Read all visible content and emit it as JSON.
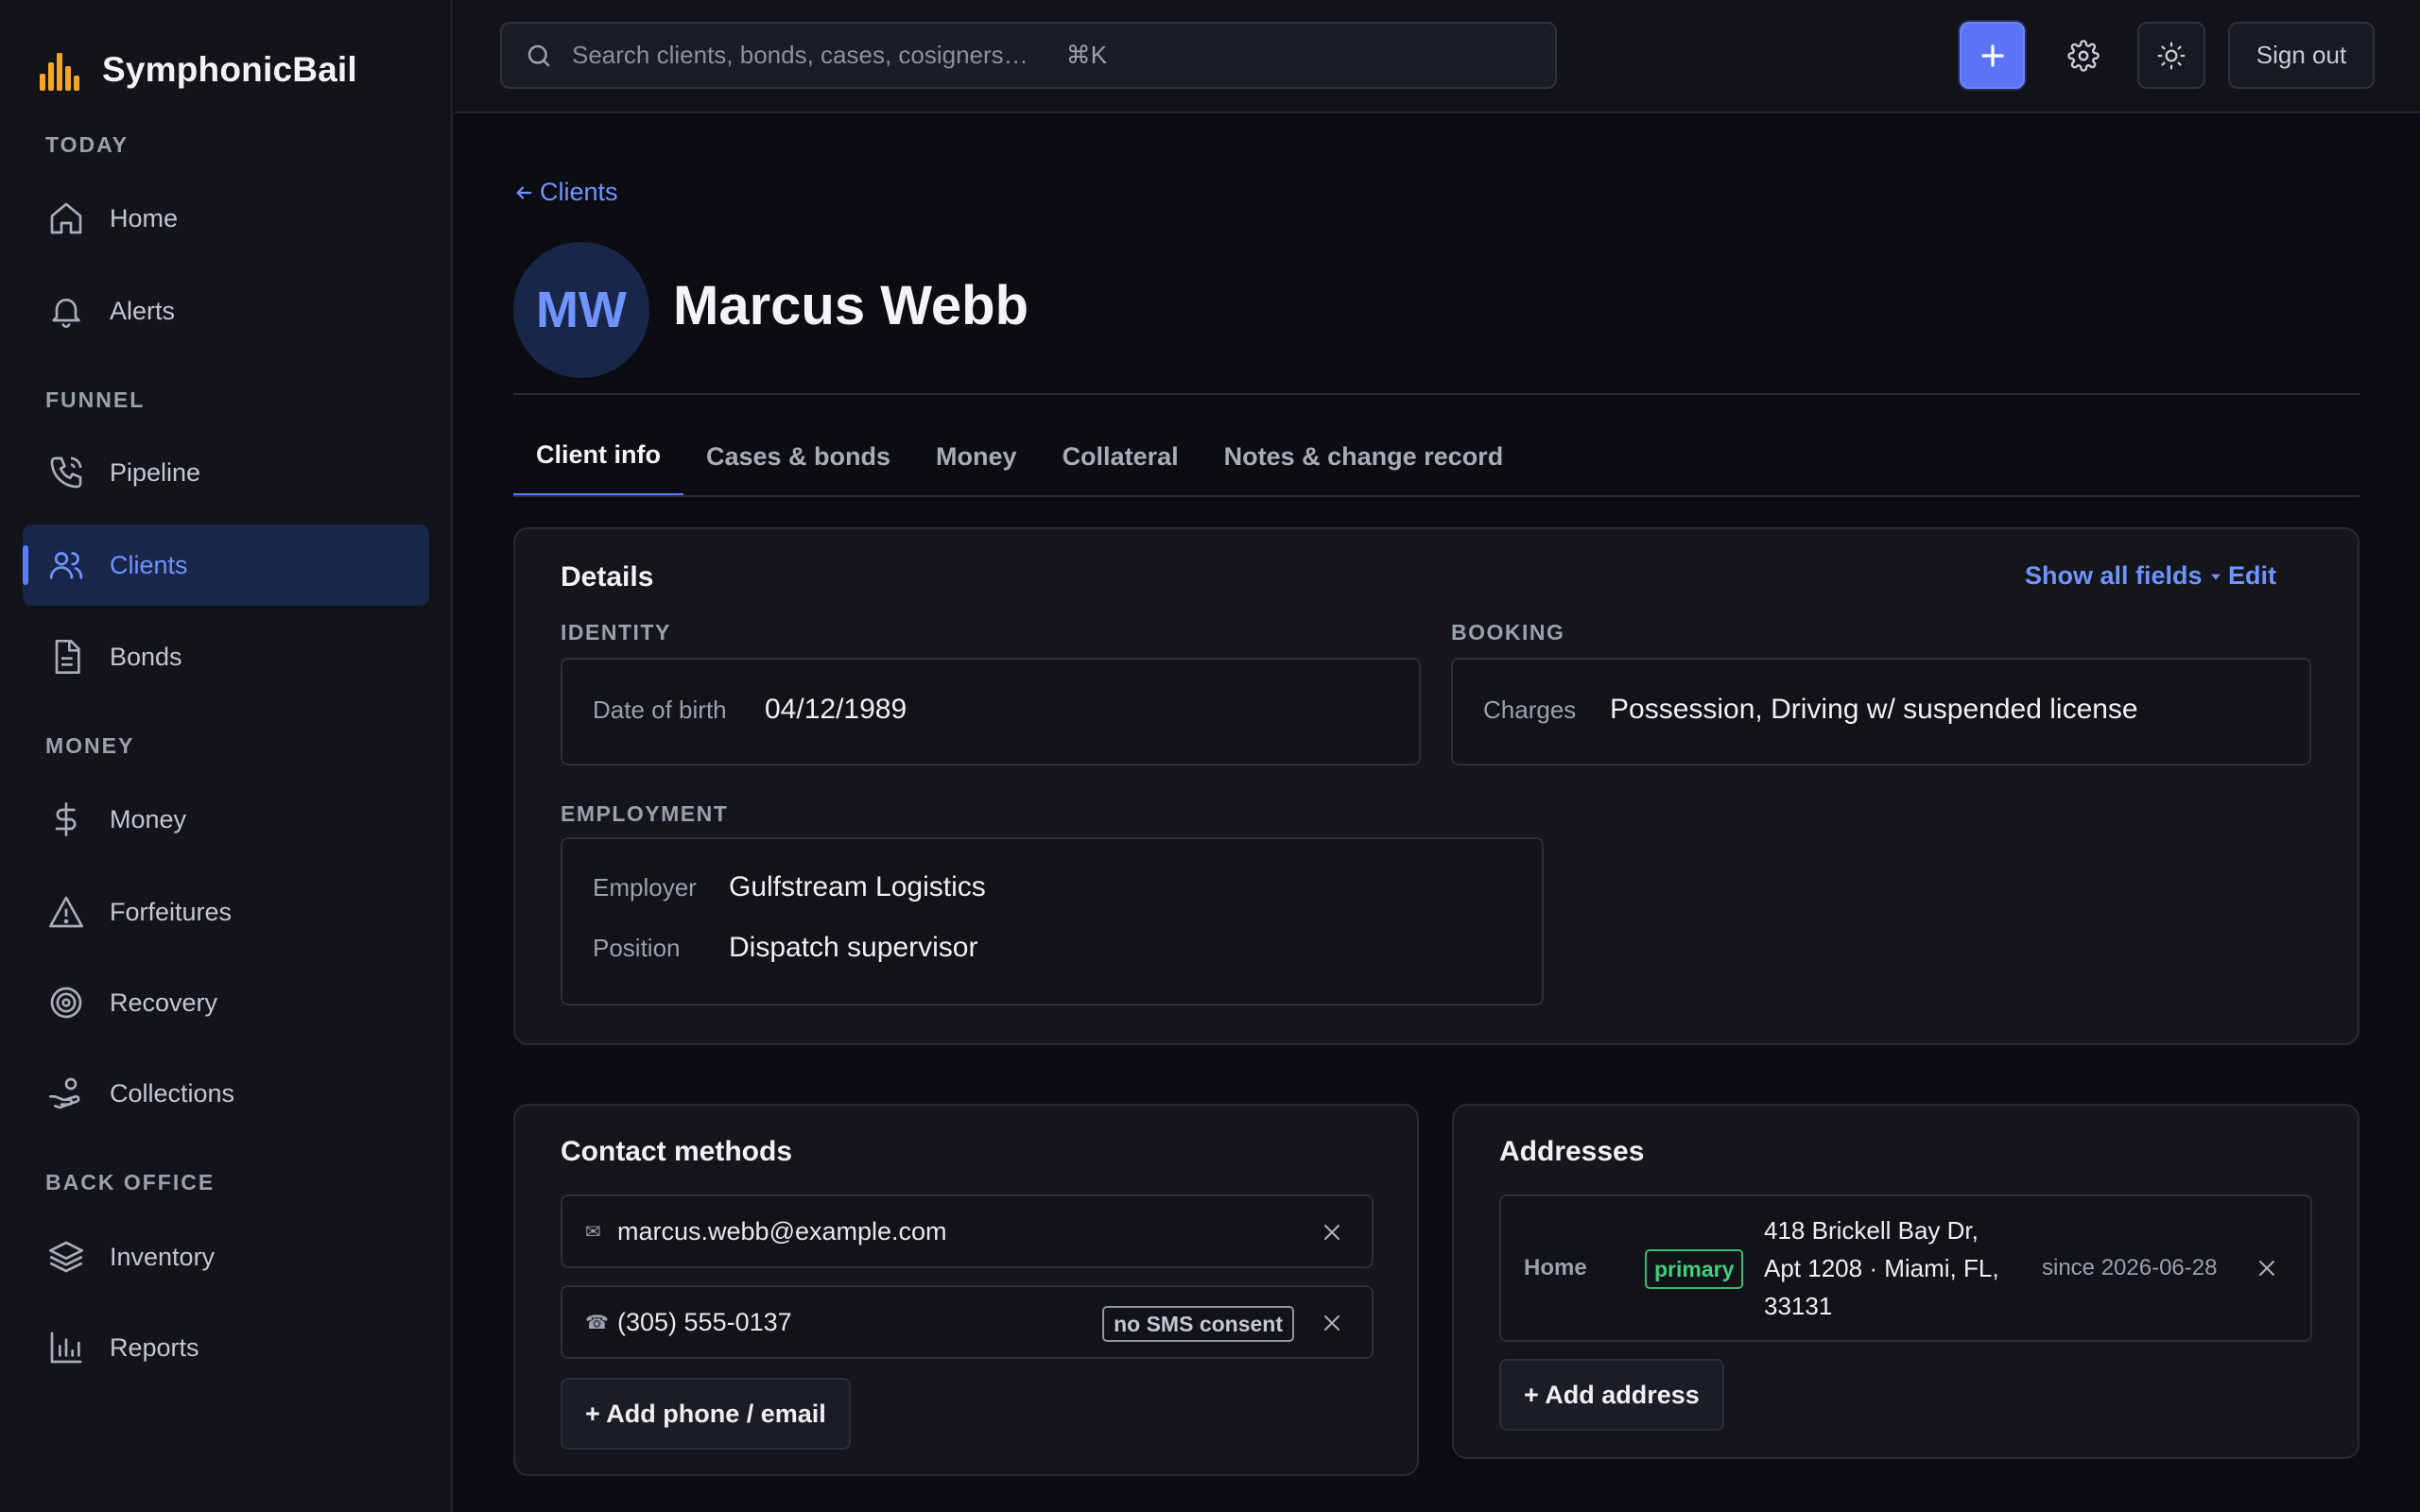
{
  "brand": {
    "name": "SymphonicBail"
  },
  "sidebar": {
    "sections": [
      {
        "title": "TODAY"
      },
      {
        "title": "FUNNEL"
      },
      {
        "title": "MONEY"
      },
      {
        "title": "BACK OFFICE"
      }
    ],
    "items": [
      {
        "label": "Home",
        "icon": "home-icon"
      },
      {
        "label": "Alerts",
        "icon": "bell-icon"
      },
      {
        "label": "Pipeline",
        "icon": "phone-icon"
      },
      {
        "label": "Clients",
        "icon": "users-icon",
        "active": true
      },
      {
        "label": "Bonds",
        "icon": "document-icon"
      },
      {
        "label": "Money",
        "icon": "dollar-icon"
      },
      {
        "label": "Forfeitures",
        "icon": "warning-icon"
      },
      {
        "label": "Recovery",
        "icon": "target-icon"
      },
      {
        "label": "Collections",
        "icon": "hand-coins-icon"
      },
      {
        "label": "Inventory",
        "icon": "layers-icon"
      },
      {
        "label": "Reports",
        "icon": "bar-chart-icon"
      }
    ]
  },
  "topbar": {
    "search_placeholder": "Search clients, bonds, cases, cosigners…",
    "search_shortcut": "⌘K",
    "sign_out_label": "Sign out"
  },
  "client": {
    "back_label": "Clients",
    "initials": "MW",
    "name": "Marcus Webb"
  },
  "tabs": [
    {
      "label": "Client info",
      "active": true
    },
    {
      "label": "Cases & bonds"
    },
    {
      "label": "Money"
    },
    {
      "label": "Collateral"
    },
    {
      "label": "Notes & change record"
    }
  ],
  "details": {
    "title": "Details",
    "show_all_label": "Show all fields",
    "edit_label": "Edit",
    "identity": {
      "title": "IDENTITY",
      "dob_label": "Date of birth",
      "dob_value": "04/12/1989"
    },
    "booking": {
      "title": "BOOKING",
      "charges_label": "Charges",
      "charges_value": "Possession, Driving w/ suspended license"
    },
    "employment": {
      "title": "EMPLOYMENT",
      "employer_label": "Employer",
      "employer_value": "Gulfstream Logistics",
      "position_label": "Position",
      "position_value": "Dispatch supervisor"
    }
  },
  "contact": {
    "title": "Contact methods",
    "email_icon": "✉",
    "email": "marcus.webb@example.com",
    "phone_icon": "☎",
    "phone": "(305) 555-0137",
    "phone_badge": "no SMS consent",
    "add_label": "+ Add phone / email"
  },
  "addresses": {
    "title": "Addresses",
    "type": "Home",
    "badge": "primary",
    "line1": "418 Brickell Bay Dr,",
    "line2": "Apt 1208 · Miami, FL,",
    "line3": "33131",
    "since": "since 2026-06-28",
    "add_label": "+ Add address"
  },
  "colors": {
    "accent": "#5b7cff",
    "active_bg": "#18264a",
    "success": "#3ed07f",
    "brand_bars": "#f5a524"
  }
}
